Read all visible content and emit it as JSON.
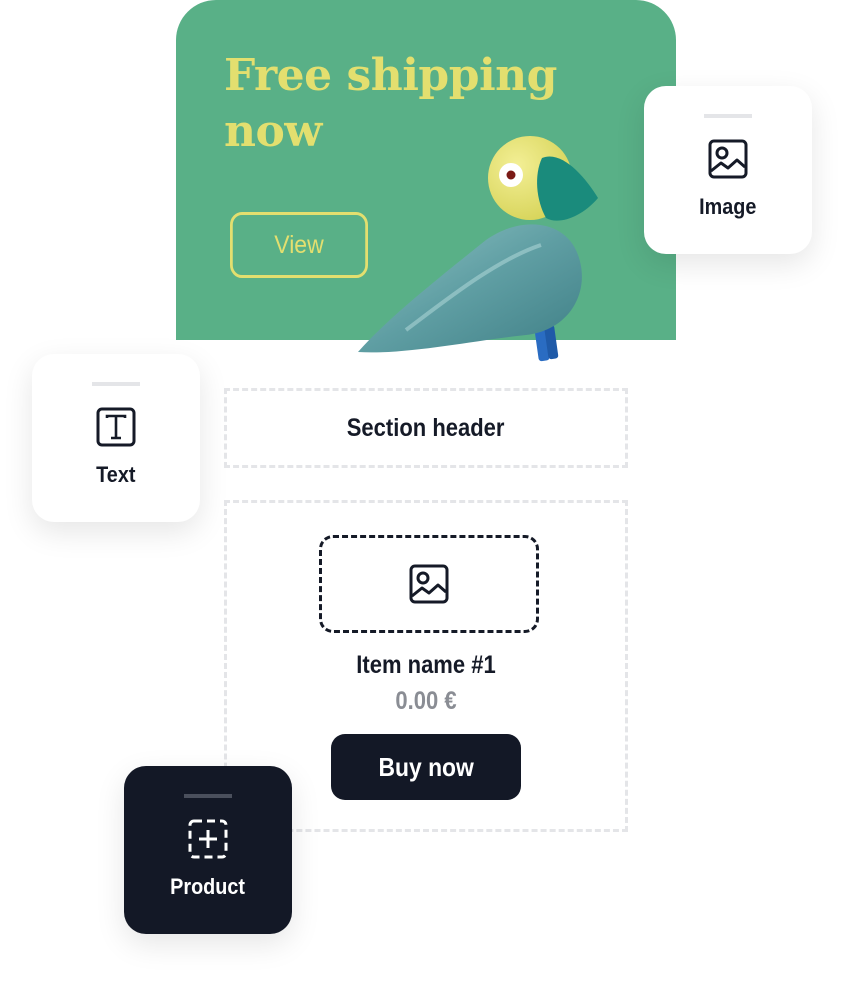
{
  "banner": {
    "title": "Free shipping now",
    "button_label": "View",
    "background_color": "#59b087",
    "accent_color": "#e3df6f",
    "image": "bird-figurine"
  },
  "cards": {
    "image": {
      "label": "Image",
      "icon": "image-icon"
    },
    "text": {
      "label": "Text",
      "icon": "text-icon"
    },
    "product": {
      "label": "Product",
      "icon": "add-product-icon"
    }
  },
  "section": {
    "header": "Section header"
  },
  "product": {
    "image_icon": "image-icon",
    "name": "Item name #1",
    "price": "0.00 €",
    "button_label": "Buy now"
  }
}
